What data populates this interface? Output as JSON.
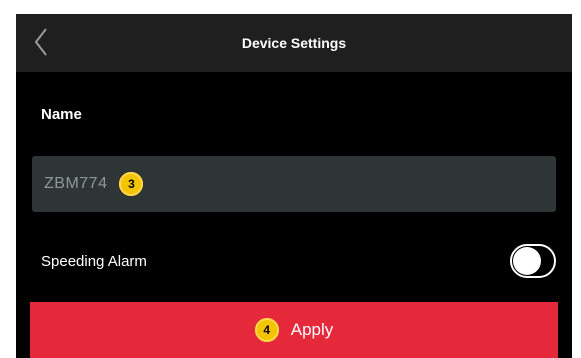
{
  "header": {
    "title": "Device Settings",
    "back_icon": "chevron-left-icon"
  },
  "form": {
    "name_label": "Name",
    "name_value": "ZBM774",
    "name_step_badge": "3",
    "speeding_label": "Speeding Alarm",
    "speeding_alarm_on": false
  },
  "apply": {
    "step_badge": "4",
    "label": "Apply"
  },
  "colors": {
    "background": "#000000",
    "header": "#1f1f1f",
    "field": "#2e3534",
    "apply": "#e5283a",
    "badge": "#f5c400"
  }
}
